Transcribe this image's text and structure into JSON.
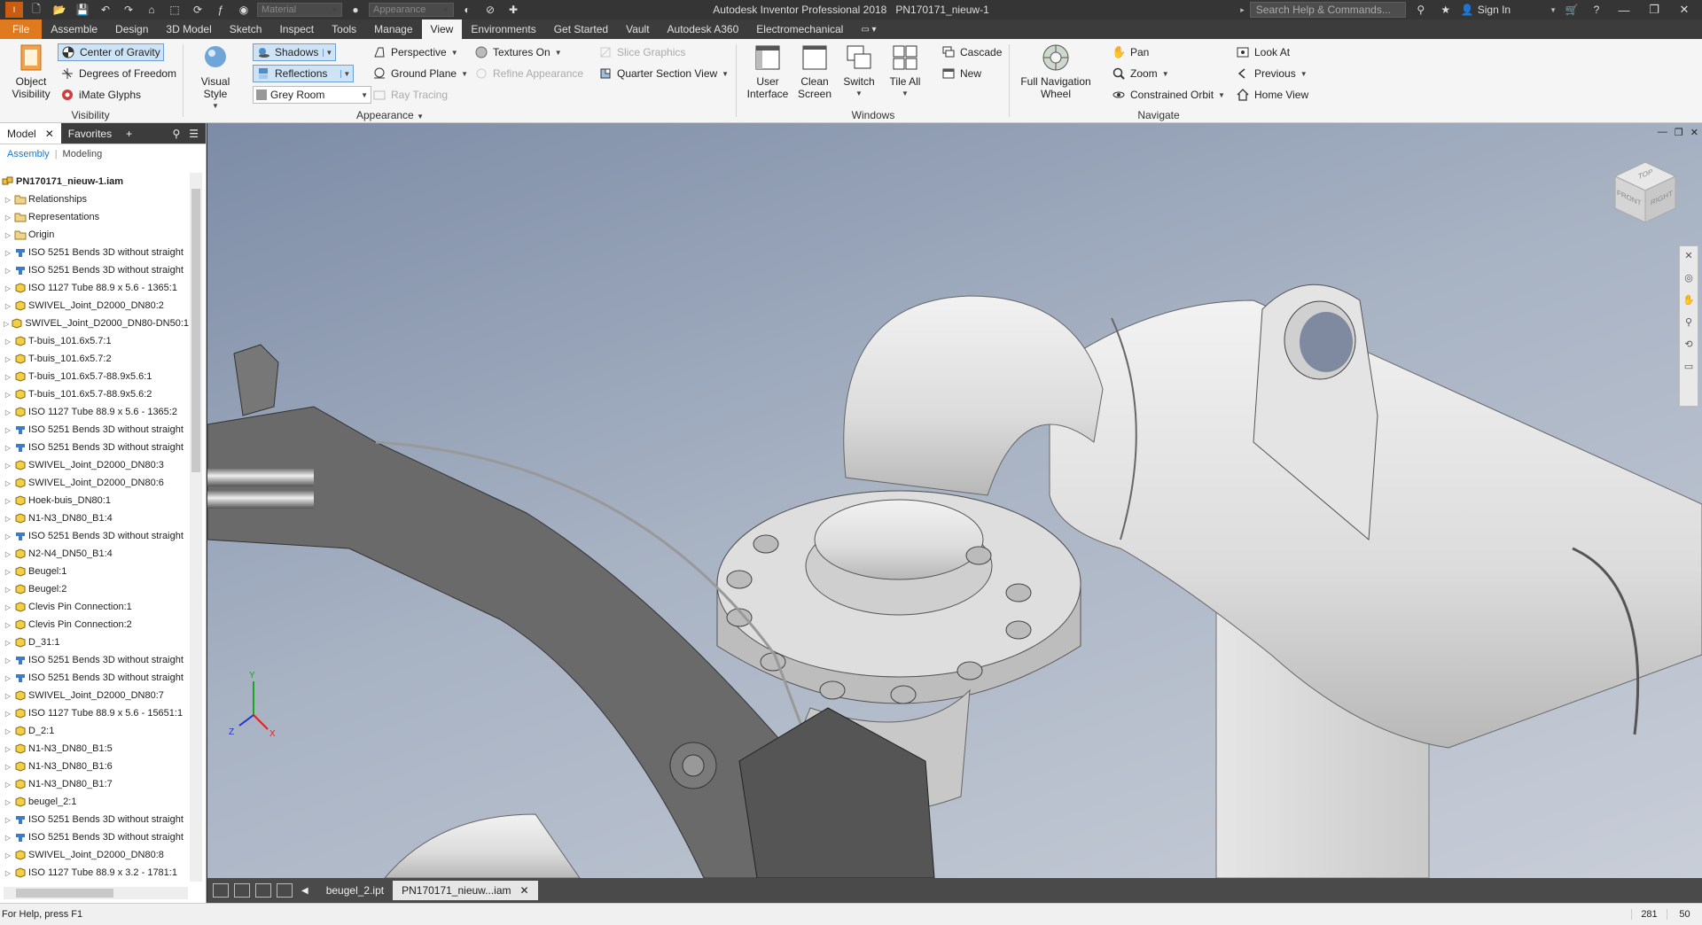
{
  "titlebar": {
    "title": "Autodesk Inventor Professional 2018",
    "document": "PN170171_nieuw-1",
    "material_placeholder": "Material",
    "appearance_placeholder": "Appearance",
    "search_placeholder": "Search Help & Commands...",
    "sign_in": "Sign In"
  },
  "tabs": [
    "File",
    "Assemble",
    "Design",
    "3D Model",
    "Sketch",
    "Inspect",
    "Tools",
    "Manage",
    "View",
    "Environments",
    "Get Started",
    "Vault",
    "Autodesk A360",
    "Electromechanical"
  ],
  "active_tab": "View",
  "ribbon": {
    "visibility": {
      "label": "Visibility",
      "object_visibility": "Object Visibility",
      "center_of_gravity": "Center of Gravity",
      "degrees_of_freedom": "Degrees of Freedom",
      "imate_glyphs": "iMate Glyphs"
    },
    "appearance": {
      "label": "Appearance",
      "visual_style": "Visual Style",
      "shadows": "Shadows",
      "reflections": "Reflections",
      "environment": "Grey Room",
      "perspective": "Perspective",
      "ground_plane": "Ground Plane",
      "ray_tracing": "Ray Tracing",
      "textures_on": "Textures On",
      "refine_appearance": "Refine Appearance",
      "slice_graphics": "Slice Graphics",
      "quarter_section_view": "Quarter Section View"
    },
    "windows": {
      "label": "Windows",
      "user_interface": "User Interface",
      "clean_screen": "Clean Screen",
      "switch": "Switch",
      "tile_all": "Tile All",
      "cascade": "Cascade",
      "new": "New"
    },
    "navigate": {
      "label": "Navigate",
      "full_nav_wheel": "Full Navigation Wheel",
      "pan": "Pan",
      "zoom": "Zoom",
      "constrained_orbit": "Constrained Orbit",
      "look_at": "Look At",
      "previous": "Previous",
      "home_view": "Home View"
    }
  },
  "browser": {
    "tab_model": "Model",
    "tab_favorites": "Favorites",
    "mode_assembly": "Assembly",
    "mode_modeling": "Modeling",
    "root": "PN170171_nieuw-1.iam",
    "items": [
      "Relationships",
      "Representations",
      "Origin",
      "ISO 5251 Bends 3D without straight",
      "ISO 5251 Bends 3D without straight",
      "ISO 1127 Tube 88.9 x 5.6 - 1365:1",
      "SWIVEL_Joint_D2000_DN80:2",
      "SWIVEL_Joint_D2000_DN80-DN50:1",
      "T-buis_101.6x5.7:1",
      "T-buis_101.6x5.7:2",
      "T-buis_101.6x5.7-88.9x5.6:1",
      "T-buis_101.6x5.7-88.9x5.6:2",
      "ISO 1127 Tube 88.9 x 5.6 - 1365:2",
      "ISO 5251 Bends 3D without straight",
      "ISO 5251 Bends 3D without straight",
      "SWIVEL_Joint_D2000_DN80:3",
      "SWIVEL_Joint_D2000_DN80:6",
      "Hoek-buis_DN80:1",
      "N1-N3_DN80_B1:4",
      "ISO 5251 Bends 3D without straight",
      "N2-N4_DN50_B1:4",
      "Beugel:1",
      "Beugel:2",
      "Clevis Pin Connection:1",
      "Clevis Pin Connection:2",
      "D_31:1",
      "ISO 5251 Bends 3D without straight",
      "ISO 5251 Bends 3D without straight",
      "SWIVEL_Joint_D2000_DN80:7",
      "ISO 1127 Tube 88.9 x 5.6 - 15651:1",
      "D_2:1",
      "N1-N3_DN80_B1:5",
      "N1-N3_DN80_B1:6",
      "N1-N3_DN80_B1:7",
      "beugel_2:1",
      "ISO 5251 Bends 3D without straight",
      "ISO 5251 Bends 3D without straight",
      "SWIVEL_Joint_D2000_DN80:8",
      "ISO 1127 Tube 88.9 x 3.2 - 1781:1"
    ]
  },
  "viewcube": {
    "top": "TOP",
    "front": "FRONT",
    "right": "RIGHT"
  },
  "doctabs": [
    "beugel_2.ipt",
    "PN170171_nieuw...iam"
  ],
  "status": {
    "help": "For Help, press F1",
    "count1": "281",
    "count2": "50"
  },
  "colors": {
    "file_tab": "#e07a1f",
    "accent_blue": "#1f78c8",
    "viewport_top": "#7d8ca6",
    "viewport_bottom": "#c9ced8"
  }
}
